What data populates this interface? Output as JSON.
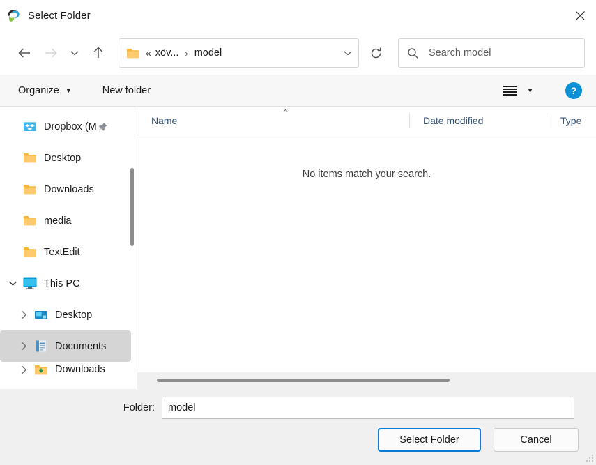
{
  "window": {
    "title": "Select Folder",
    "app_icon": "app-logo-icon",
    "close_label": "×"
  },
  "navigation": {
    "back_icon": "back-arrow-icon",
    "forward_icon": "forward-arrow-icon",
    "recent_icon": "chevron-down-icon",
    "up_icon": "up-arrow-icon",
    "refresh_icon": "refresh-icon",
    "breadcrumb": {
      "folder_icon": "folder-icon",
      "overflow": "«",
      "parent": "xöv...",
      "separator": "›",
      "current": "model",
      "dropdown_icon": "chevron-down-icon"
    },
    "search": {
      "icon": "search-icon",
      "placeholder": "Search model",
      "value": ""
    }
  },
  "toolbar": {
    "organize_label": "Organize",
    "organize_caret": "▼",
    "new_folder_label": "New folder",
    "view_icon": "view-layout-icon",
    "view_caret": "▼",
    "help_label": "?"
  },
  "sidebar": {
    "items": [
      {
        "label": "Dropbox (M",
        "icon": "dropbox-folder-icon",
        "indent": 1,
        "twisty": "",
        "pinned": true,
        "selected": false
      },
      {
        "label": "Desktop",
        "icon": "folder-icon",
        "indent": 1,
        "twisty": "",
        "pinned": false,
        "selected": false
      },
      {
        "label": "Downloads",
        "icon": "folder-icon",
        "indent": 1,
        "twisty": "",
        "pinned": false,
        "selected": false
      },
      {
        "label": "media",
        "icon": "folder-icon",
        "indent": 1,
        "twisty": "",
        "pinned": false,
        "selected": false
      },
      {
        "label": "TextEdit",
        "icon": "folder-icon",
        "indent": 1,
        "twisty": "",
        "pinned": false,
        "selected": false
      },
      {
        "label": "This PC",
        "icon": "this-pc-icon",
        "indent": 0,
        "twisty": "expanded",
        "pinned": false,
        "selected": false
      },
      {
        "label": "Desktop",
        "icon": "desktop-blue-icon",
        "indent": 2,
        "twisty": "collapsed",
        "pinned": false,
        "selected": false
      },
      {
        "label": "Documents",
        "icon": "documents-icon",
        "indent": 2,
        "twisty": "collapsed",
        "pinned": false,
        "selected": true
      },
      {
        "label": "Downloads",
        "icon": "downloads-icon",
        "indent": 2,
        "twisty": "collapsed",
        "pinned": false,
        "selected": false
      }
    ]
  },
  "file_list": {
    "columns": [
      {
        "label": "Name",
        "sorted": "ascending",
        "sort_glyph": "⌃"
      },
      {
        "label": "Date modified",
        "sorted": "",
        "sort_glyph": ""
      },
      {
        "label": "Type",
        "sorted": "",
        "sort_glyph": ""
      }
    ],
    "empty_message": "No items match your search.",
    "rows": []
  },
  "footer": {
    "folder_label": "Folder:",
    "folder_value": "model",
    "select_button": "Select Folder",
    "cancel_button": "Cancel"
  }
}
